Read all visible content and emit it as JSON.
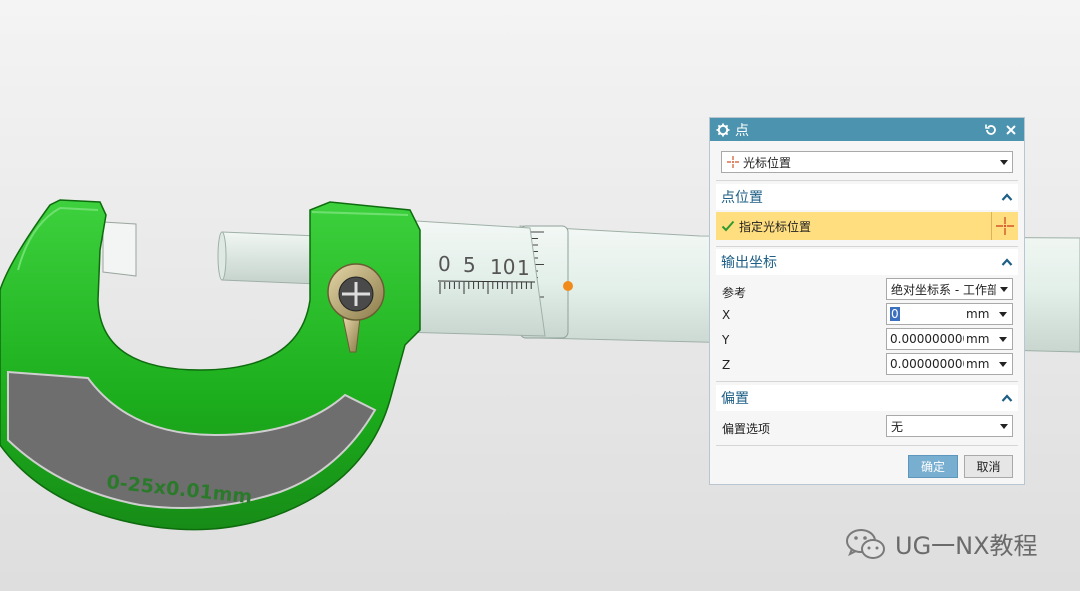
{
  "scene": {
    "frame_text": "0-25x0.01mm",
    "scale_numbers": [
      "0",
      "5",
      "10",
      "1"
    ],
    "colors": {
      "frame": "#1fb81f",
      "plate": "#6e6e6e",
      "sleeve": "#e3efe9",
      "accent_arrow": "#e84a3c"
    }
  },
  "dialog": {
    "title": "点",
    "icons": {
      "title": "gear-icon",
      "reset": "reset-icon",
      "close": "close-icon"
    },
    "type_select": {
      "value": "光标位置",
      "icon": "crosshair-icon"
    },
    "point_location": {
      "header": "点位置",
      "select_label": "指定光标位置"
    },
    "output_coords": {
      "header": "输出坐标",
      "reference_label": "参考",
      "reference_value": "绝对坐标系 - 工作部",
      "x_label": "X",
      "x_value": "0",
      "y_label": "Y",
      "y_value": "0.0000000000",
      "z_label": "Z",
      "z_value": "0.0000000000",
      "unit": "mm"
    },
    "offset": {
      "header": "偏置",
      "option_label": "偏置选项",
      "option_value": "无"
    },
    "buttons": {
      "ok": "确定",
      "cancel": "取消"
    },
    "colors": {
      "titlebar": "#4b93ae",
      "section_text": "#1d5f86",
      "selection_highlight": "#ffde7f",
      "ok_button": "#78aed0"
    }
  },
  "watermark": {
    "label": "UG一NX教程",
    "icon": "wechat-icon"
  }
}
